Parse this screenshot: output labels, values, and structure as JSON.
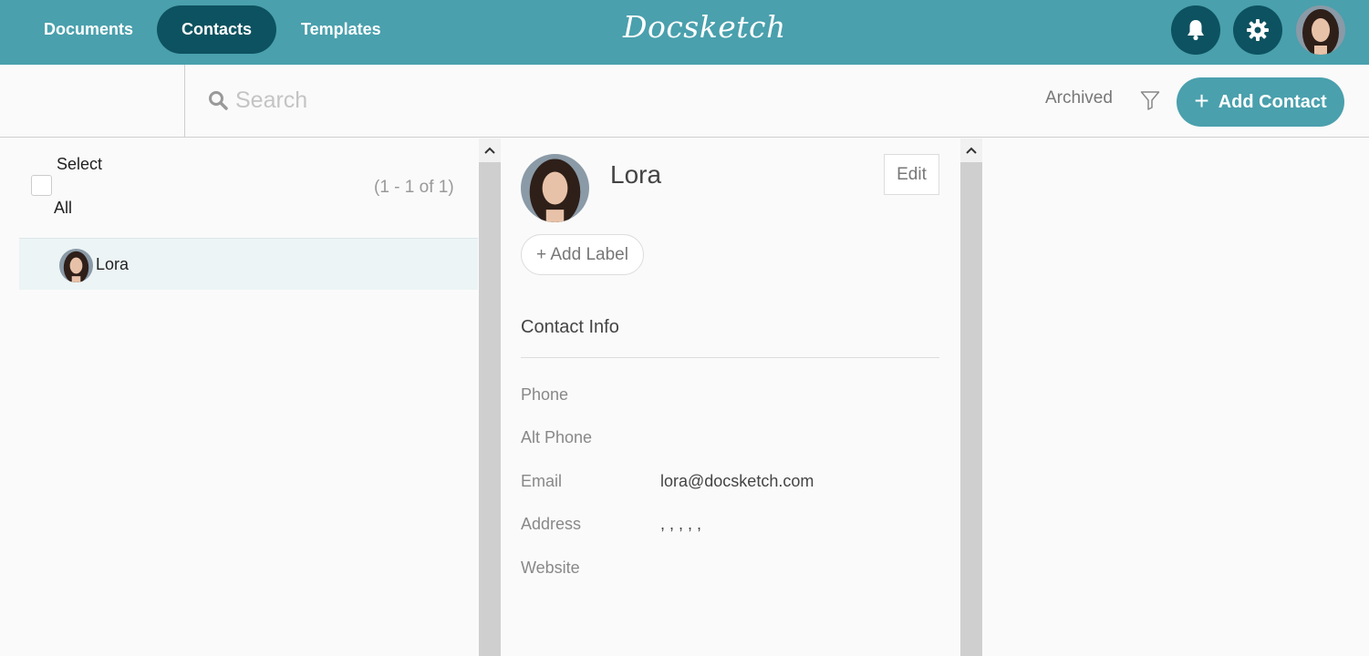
{
  "nav": {
    "tabs": [
      {
        "label": "Documents"
      },
      {
        "label": "Contacts"
      },
      {
        "label": "Templates"
      }
    ],
    "logo": "Docsketch",
    "bell_icon": "bell-icon",
    "settings_icon": "gear-icon"
  },
  "toolbar": {
    "search_placeholder": "Search",
    "archived_label": "Archived",
    "add_contact_label": "Add Contact"
  },
  "list": {
    "select_all_line1": "Select",
    "select_all_line2": "All",
    "pager": "(1 - 1 of 1)",
    "items": [
      {
        "name": "Lora"
      }
    ]
  },
  "detail": {
    "name": "Lora",
    "edit_label": "Edit",
    "add_label": "+ Add Label",
    "section_title": "Contact Info",
    "fields": [
      {
        "label": "Phone",
        "value": ""
      },
      {
        "label": "Alt Phone",
        "value": ""
      },
      {
        "label": "Email",
        "value": "lora@docsketch.com"
      },
      {
        "label": "Address",
        "value": ", , , , ,"
      },
      {
        "label": "Website",
        "value": ""
      }
    ]
  },
  "colors": {
    "brand": "#4aa0ad",
    "brand_dark": "#0d5260",
    "selected_row": "#ecf4f5"
  }
}
